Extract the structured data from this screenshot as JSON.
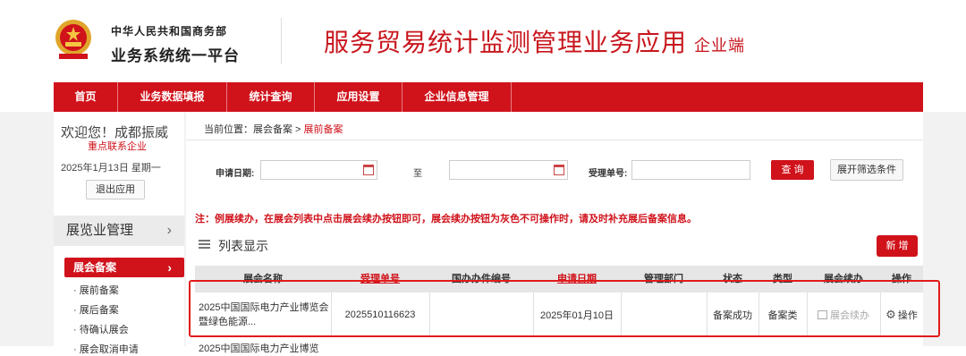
{
  "header": {
    "org_line1": "中华人民共和国商务部",
    "org_line2": "业务系统统一平台",
    "app_title": "服务贸易统计监测管理业务应用",
    "app_subtitle": "企业端"
  },
  "nav": [
    "首页",
    "业务数据填报",
    "统计查询",
    "应用设置",
    "企业信息管理"
  ],
  "sidebar": {
    "welcome": "欢迎您！成都振威",
    "tag": "重点联系企业",
    "date": "2025年1月13日 星期一",
    "logout": "退出应用",
    "section": "展览业管理",
    "selected": "展会备案",
    "sub_items": [
      "· 展前备案",
      "· 展后备案",
      "· 待确认展会",
      "· 展会取消申请"
    ]
  },
  "breadcrumb": {
    "prefix": "当前位置：",
    "path": "展会备案 > ",
    "current": "展前备案"
  },
  "filter": {
    "date_label": "申请日期:",
    "to_label": "至",
    "receipt_label": "受理单号:",
    "query_button": "查 询",
    "expand_button": "展开筛选条件"
  },
  "notice": "注：例展续办，在展会列表中点击展会续办按钮即可，展会续办按钮为灰色不可操作时，请及时补充展后备案信息。",
  "list": {
    "title": "列表显示",
    "add_button": "新 增"
  },
  "table": {
    "headers": [
      "展会名称",
      "受理单号",
      "国办办件编号",
      "申请日期",
      "管理部门",
      "状态",
      "类型",
      "展会续办",
      "操作"
    ],
    "row": {
      "name": "2025中国国际电力产业博览会暨绿色能源...",
      "receipt": "2025510116623",
      "gov_no": "",
      "date": "2025年01月10日",
      "dept": "",
      "status": "备案成功",
      "type": "备案类",
      "renew": "展会续办",
      "action": "操作"
    },
    "next_row_partial": "2025中国国际电力产业博览"
  },
  "colors": {
    "brand_red": "#d0121b",
    "highlight": "#e21b1b"
  }
}
